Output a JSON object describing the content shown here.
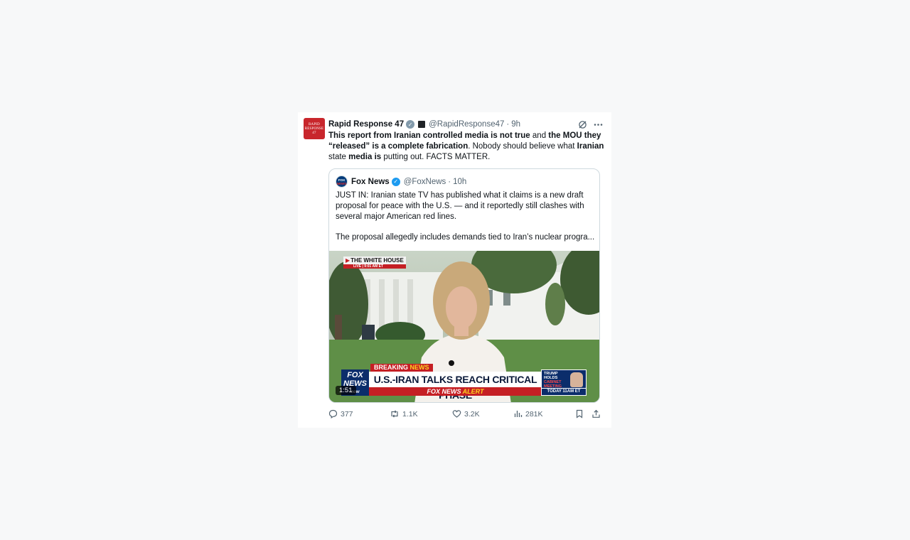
{
  "post": {
    "author": {
      "name": "Rapid Response 47",
      "handle": "@RapidResponse47",
      "time": "9h",
      "avatar_lines": [
        "RAPID",
        "RESPONSE",
        "47"
      ],
      "verified_badge": "grey-check-icon"
    },
    "text_segments": [
      {
        "text": "This report from Iranian controlled media is not true",
        "bold": true
      },
      {
        "text": " and ",
        "bold": false
      },
      {
        "text": "the MOU they “released” is a complete fabrication",
        "bold": true
      },
      {
        "text": ". Nobody should believe what ",
        "bold": false
      },
      {
        "text": "Iranian",
        "bold": true
      },
      {
        "text": " state ",
        "bold": false
      },
      {
        "text": "media is",
        "bold": true
      },
      {
        "text": " putting out. FACTS MATTER.",
        "bold": false
      }
    ],
    "quoted": {
      "author": {
        "name": "Fox News",
        "handle": "@FoxNews",
        "time": "10h",
        "avatar_top": "FOX",
        "avatar_bottom": "NEWS"
      },
      "paragraph1": "JUST IN: Iranian state TV has published what it claims is a new draft proposal for peace with the U.S. — and it reportedly still clashes with several major American red lines.",
      "paragraph2": "The proposal allegedly includes demands tied to Iran’s nuclear progra...",
      "video": {
        "location_tag": "THE WHITE HOUSE",
        "live_tag": "LIVE | 9:01 AM ET",
        "breaking_part1": "BREAKING",
        "breaking_part2": "NEWS",
        "headline": "U.S.-IRAN TALKS REACH CRITICAL PHASE",
        "alert_part1": "FOX NEWS",
        "alert_part2": "ALERT",
        "logo_line1": "FOX",
        "logo_line2": "NEWS",
        "logo_line3": "now",
        "side_line1": "TRUMP",
        "side_line2": "HOLDS",
        "side_line3": "CABINET",
        "side_line4": "MEETING",
        "side_time": "TODAY 11AM ET",
        "duration": "1:51"
      }
    },
    "actions": {
      "replies": "377",
      "reposts": "1.1K",
      "likes": "3.2K",
      "views": "281K"
    }
  }
}
